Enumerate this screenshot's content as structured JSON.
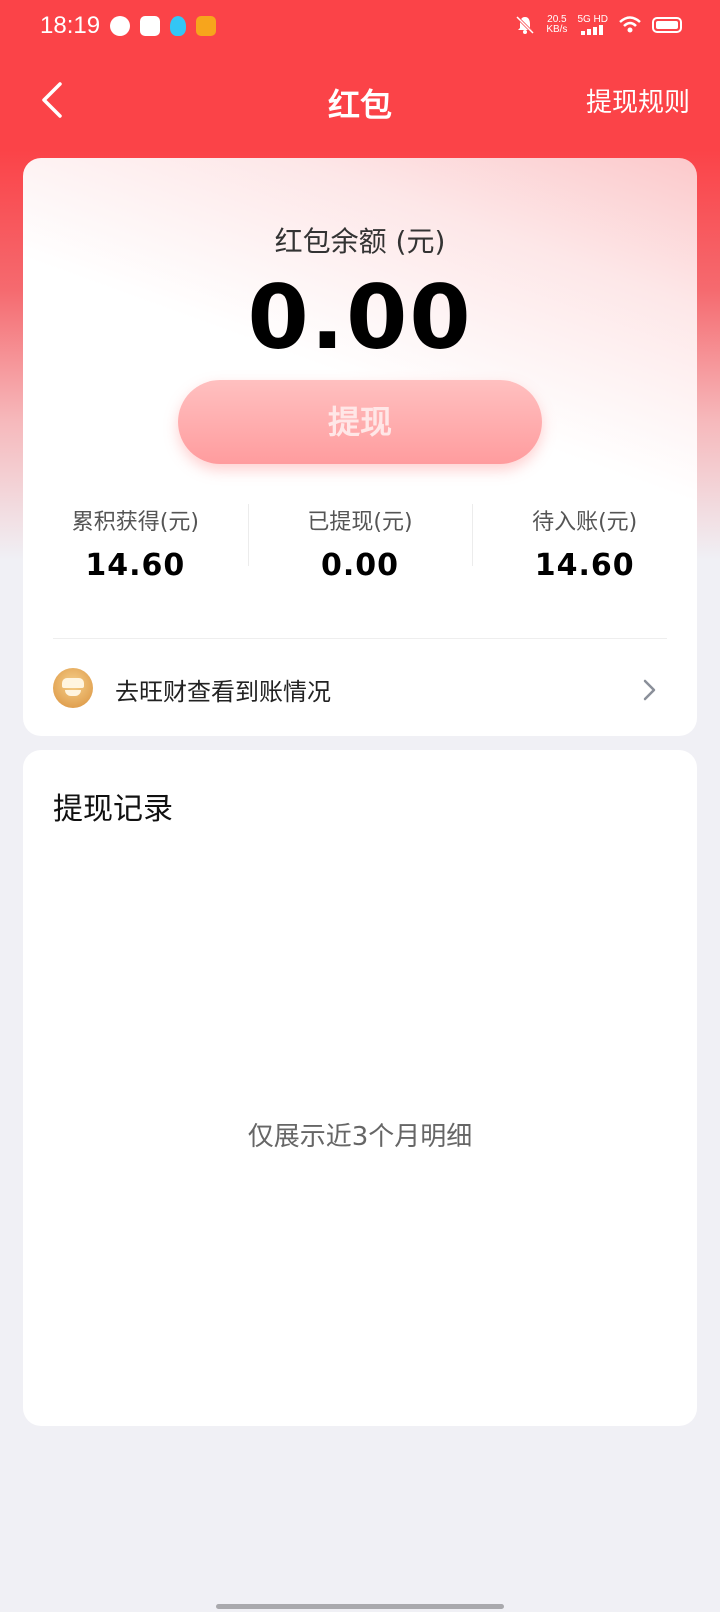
{
  "status_bar": {
    "time": "18:19",
    "net_speed_value": "20.5",
    "net_speed_unit": "KB/s",
    "signal_text": "5G HD"
  },
  "header": {
    "title": "红包",
    "rules_link": "提现规则"
  },
  "balance_card": {
    "label": "红包余额 (元)",
    "amount": "0.00",
    "withdraw_button": "提现",
    "stats": [
      {
        "label": "累积获得(元)",
        "value": "14.60"
      },
      {
        "label": "已提现(元)",
        "value": "0.00"
      },
      {
        "label": "待入账(元)",
        "value": "14.60"
      }
    ],
    "check_row_text": "去旺财查看到账情况"
  },
  "records_card": {
    "title": "提现记录",
    "empty_hint": "仅展示近3个月明细"
  },
  "colors": {
    "brand_red": "#fb4348",
    "button_pink": "#ff9c9e"
  },
  "icons": [
    "back-chevron-icon",
    "coin-icon",
    "chevron-right-icon",
    "message-icon",
    "shop-icon",
    "qq-icon",
    "app-icon",
    "mute-bell-icon",
    "wifi-icon",
    "battery-icon"
  ]
}
